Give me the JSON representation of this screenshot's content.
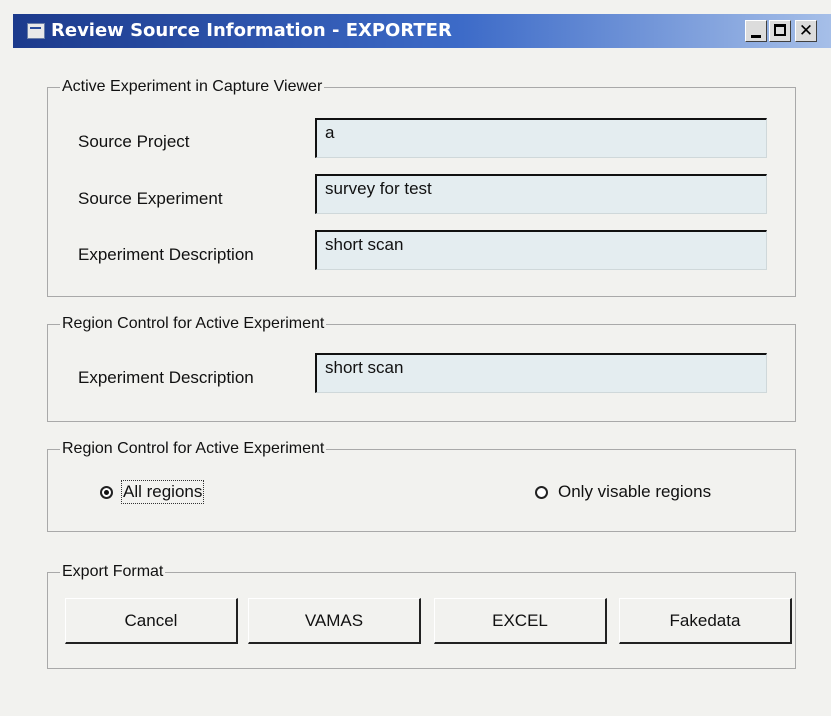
{
  "window": {
    "title": "Review Source Information - EXPORTER",
    "controls": {
      "minimize": "_",
      "maximize": "□",
      "close": "✕"
    }
  },
  "group_active": {
    "legend": "Active Experiment in Capture Viewer",
    "source_project_label": "Source Project",
    "source_project_value": "a",
    "source_experiment_label": "Source Experiment",
    "source_experiment_value": "survey for test",
    "experiment_description_label": "Experiment Description",
    "experiment_description_value": "short scan"
  },
  "group_region_1": {
    "legend": "Region Control for Active Experiment",
    "experiment_description_label": "Experiment Description",
    "experiment_description_value": "short scan"
  },
  "group_region_2": {
    "legend": "Region Control for Active Experiment",
    "radio_all": "All regions",
    "radio_visible": "Only visable regions",
    "selected": "All regions"
  },
  "group_export": {
    "legend": "Export Format",
    "buttons": [
      "Cancel",
      "VAMAS",
      "EXCEL",
      "Fakedata"
    ]
  }
}
